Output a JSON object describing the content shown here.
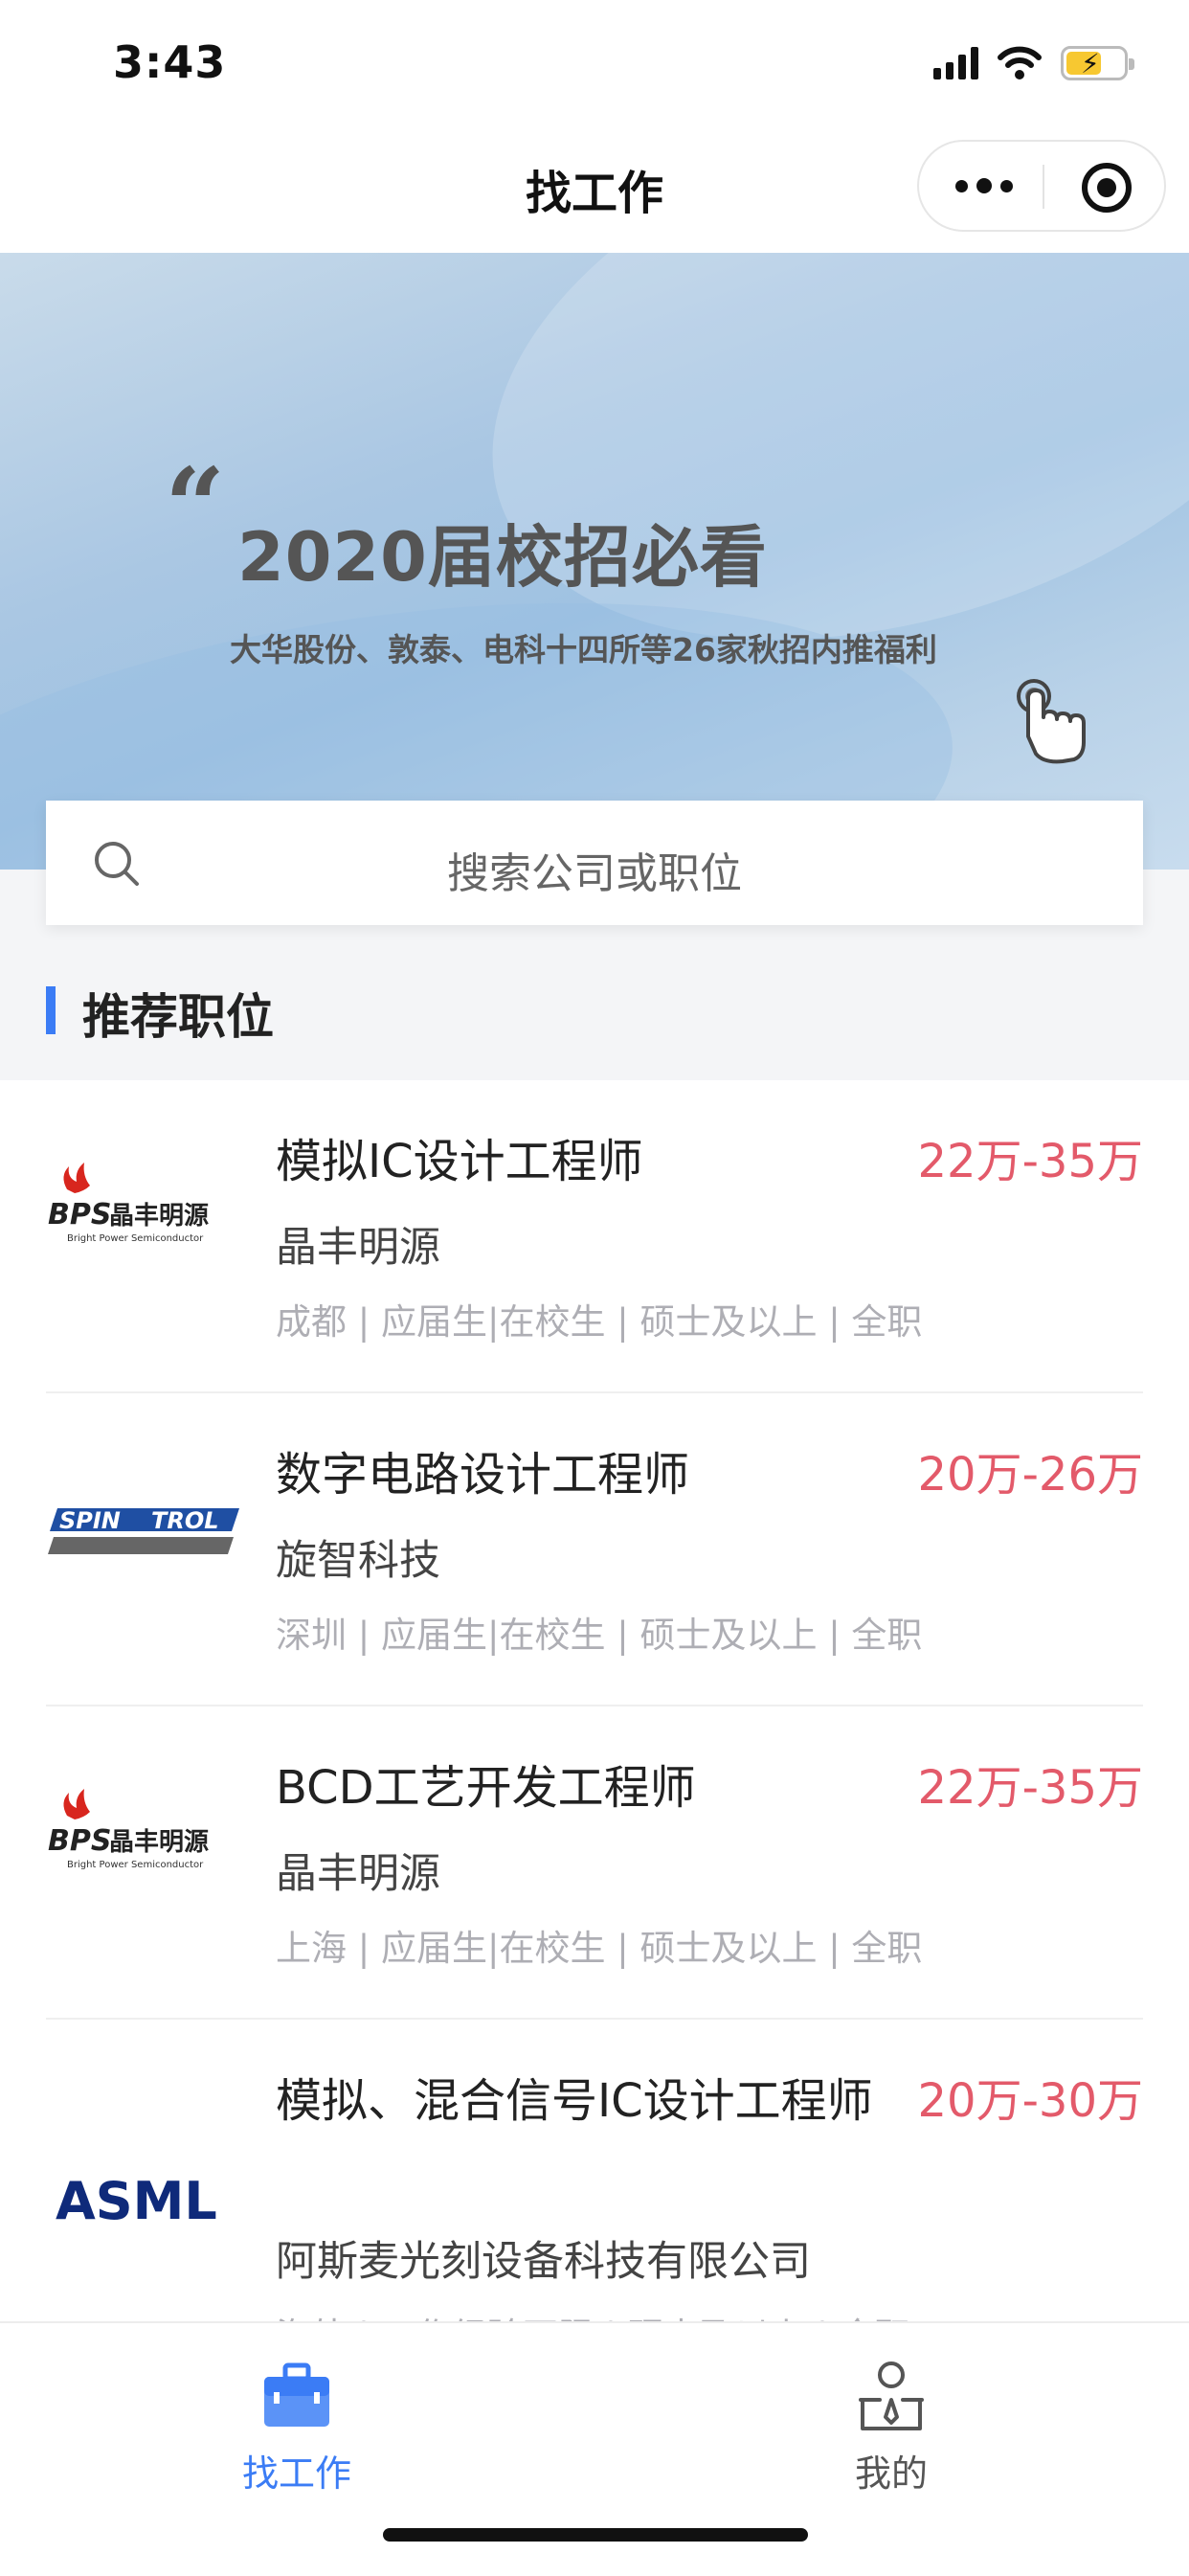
{
  "status_bar": {
    "time": "3:43"
  },
  "nav": {
    "title": "找工作"
  },
  "banner": {
    "title": "2020届校招必看",
    "subtitle": "大华股份、敦泰、电科十四所等26家秋招内推福利"
  },
  "search": {
    "placeholder": "搜索公司或职位"
  },
  "section": {
    "title": "推荐职位"
  },
  "jobs": [
    {
      "title": "模拟IC设计工程师",
      "salary": "22万-35万",
      "company": "晶丰明源",
      "tags": "成都 | 应届生|在校生 | 硕士及以上 | 全职",
      "logo": "bps-logo",
      "logo_text": "晶丰明源",
      "logo_sub": "Bright Power Semiconductor"
    },
    {
      "title": "数字电路设计工程师",
      "salary": "20万-26万",
      "company": "旋智科技",
      "tags": "深圳 | 应届生|在校生 | 硕士及以上 | 全职",
      "logo": "spintrol-logo",
      "logo_text_a": "SPIN",
      "logo_text_b": "TROL"
    },
    {
      "title": "BCD工艺开发工程师",
      "salary": "22万-35万",
      "company": "晶丰明源",
      "tags": "上海 | 应届生|在校生 | 硕士及以上 | 全职",
      "logo": "bps-logo",
      "logo_text": "晶丰明源",
      "logo_sub": "Bright Power Semiconductor"
    },
    {
      "title": "模拟、混合信号IC设计工程师",
      "salary": "20万-30万",
      "company": "阿斯麦光刻设备科技有限公司",
      "tags": "海外 | 工作经验不限 | 硕士及以上 | 全职",
      "logo": "asml-logo",
      "logo_text": "ASML"
    }
  ],
  "tabbar": {
    "tabs": [
      {
        "label": "找工作",
        "icon": "briefcase-icon",
        "active": true
      },
      {
        "label": "我的",
        "icon": "person-icon",
        "active": false
      }
    ]
  },
  "colors": {
    "accent": "#3b7cf5",
    "salary": "#e35a6a",
    "tag": "#aeaeb4"
  }
}
